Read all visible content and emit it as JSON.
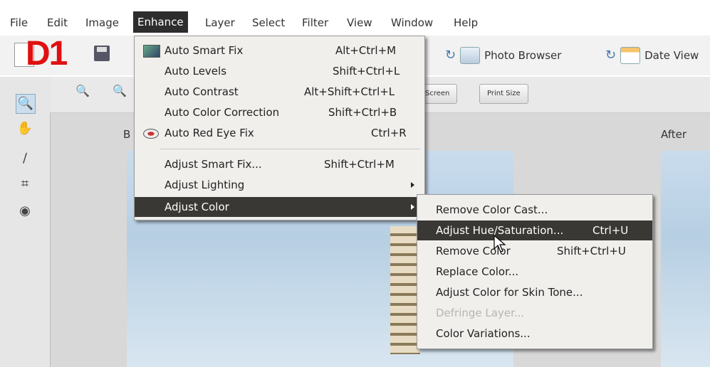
{
  "overlay_label": "D1",
  "menubar": {
    "items": [
      "File",
      "Edit",
      "Image",
      "Enhance",
      "Layer",
      "Select",
      "Filter",
      "View",
      "Window",
      "Help"
    ],
    "active": "Enhance"
  },
  "toolbar": {
    "photo_browser": "Photo Browser",
    "date_view": "Date View"
  },
  "subbar": {
    "screen_btn": "Screen",
    "print_size_btn": "Print Size"
  },
  "workspace": {
    "before_label": "B",
    "after_label": "After"
  },
  "enhance_menu": {
    "items": [
      {
        "label": "Auto Smart Fix",
        "shortcut": "Alt+Ctrl+M",
        "icon": "auto-smart-fix-icon"
      },
      {
        "label": "Auto Levels",
        "shortcut": "Shift+Ctrl+L"
      },
      {
        "label": "Auto Contrast",
        "shortcut": "Alt+Shift+Ctrl+L"
      },
      {
        "label": "Auto Color Correction",
        "shortcut": "Shift+Ctrl+B"
      },
      {
        "label": "Auto Red Eye Fix",
        "shortcut": "Ctrl+R",
        "icon": "red-eye-icon"
      },
      {
        "label": "Adjust Smart Fix...",
        "shortcut": "Shift+Ctrl+M"
      },
      {
        "label": "Adjust Lighting",
        "shortcut": ""
      },
      {
        "label": "Adjust Color",
        "shortcut": "",
        "highlighted": true
      }
    ]
  },
  "adjust_color_submenu": {
    "items": [
      {
        "label": "Remove Color Cast...",
        "shortcut": ""
      },
      {
        "label": "Adjust Hue/Saturation...",
        "shortcut": "Ctrl+U",
        "highlighted": true
      },
      {
        "label": "Remove Color",
        "shortcut": "Shift+Ctrl+U"
      },
      {
        "label": "Replace Color...",
        "shortcut": ""
      },
      {
        "label": "Adjust Color for Skin Tone...",
        "shortcut": ""
      },
      {
        "label": "Defringe Layer...",
        "shortcut": "",
        "disabled": true
      },
      {
        "label": "Color Variations...",
        "shortcut": ""
      }
    ]
  },
  "colors": {
    "menu_highlight": "#3a3835",
    "overlay_red": "#e01010"
  }
}
